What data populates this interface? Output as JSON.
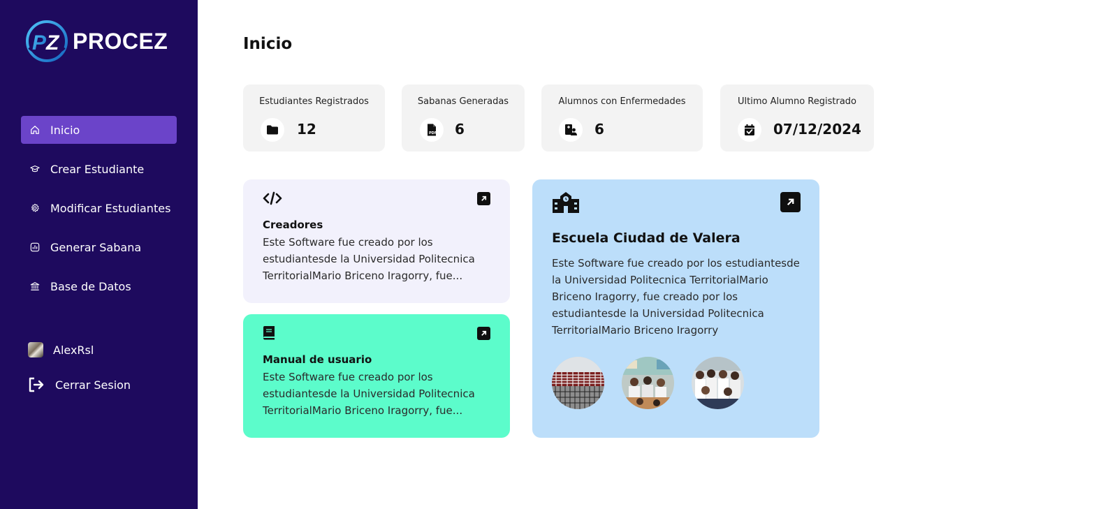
{
  "brand": {
    "name": "PROCEZ",
    "mark": "PZ"
  },
  "sidebar": {
    "items": [
      {
        "label": "Inicio",
        "icon": "home-icon",
        "active": true
      },
      {
        "label": "Crear Estudiante",
        "icon": "graduation-cap-icon",
        "active": false
      },
      {
        "label": "Modificar Estudiantes",
        "icon": "gear-icon",
        "active": false
      },
      {
        "label": "Generar Sabana",
        "icon": "chart-icon",
        "active": false
      },
      {
        "label": "Base de Datos",
        "icon": "bank-icon",
        "active": false
      }
    ],
    "user": {
      "name": "AlexRsl"
    },
    "logout": {
      "label": "Cerrar Sesion",
      "icon": "logout-icon"
    }
  },
  "main": {
    "title": "Inicio",
    "stats": [
      {
        "label": "Estudiantes Registrados",
        "value": "12",
        "icon": "folder-icon"
      },
      {
        "label": "Sabanas Generadas",
        "value": "6",
        "icon": "pdf-file-icon"
      },
      {
        "label": "Alumnos con Enfermedades",
        "value": "6",
        "icon": "user-id-card-icon"
      },
      {
        "label": "Ultimo Alumno Registrado",
        "value": "07/12/2024",
        "icon": "calendar-check-icon"
      }
    ],
    "cards": {
      "creators": {
        "title": "Creadores",
        "text": "Este Software fue creado por los estudiantesde la Universidad Politecnica TerritorialMario Briceno Iragorry, fue...",
        "icon": "code-icon",
        "bg": "#f2f1fc"
      },
      "manual": {
        "title": "Manual de usuario",
        "text": "Este Software fue creado por los estudiantesde la Universidad Politecnica TerritorialMario Briceno Iragorry, fue...",
        "icon": "book-icon",
        "bg": "#5cfccb"
      },
      "school": {
        "title": "Escuela Ciudad de Valera",
        "text": "Este Software fue creado por los estudiantesde la Universidad Politecnica TerritorialMario Briceno Iragorry, fue creado por los estudiantesde la Universidad Politecnica TerritorialMario Briceno Iragorry",
        "icon": "school-icon",
        "bg": "#bcdefa"
      }
    }
  },
  "colors": {
    "sidebar_bg": "#1e0a5e",
    "active_item": "#6b44c9",
    "stat_bg": "#f3f3f3"
  }
}
